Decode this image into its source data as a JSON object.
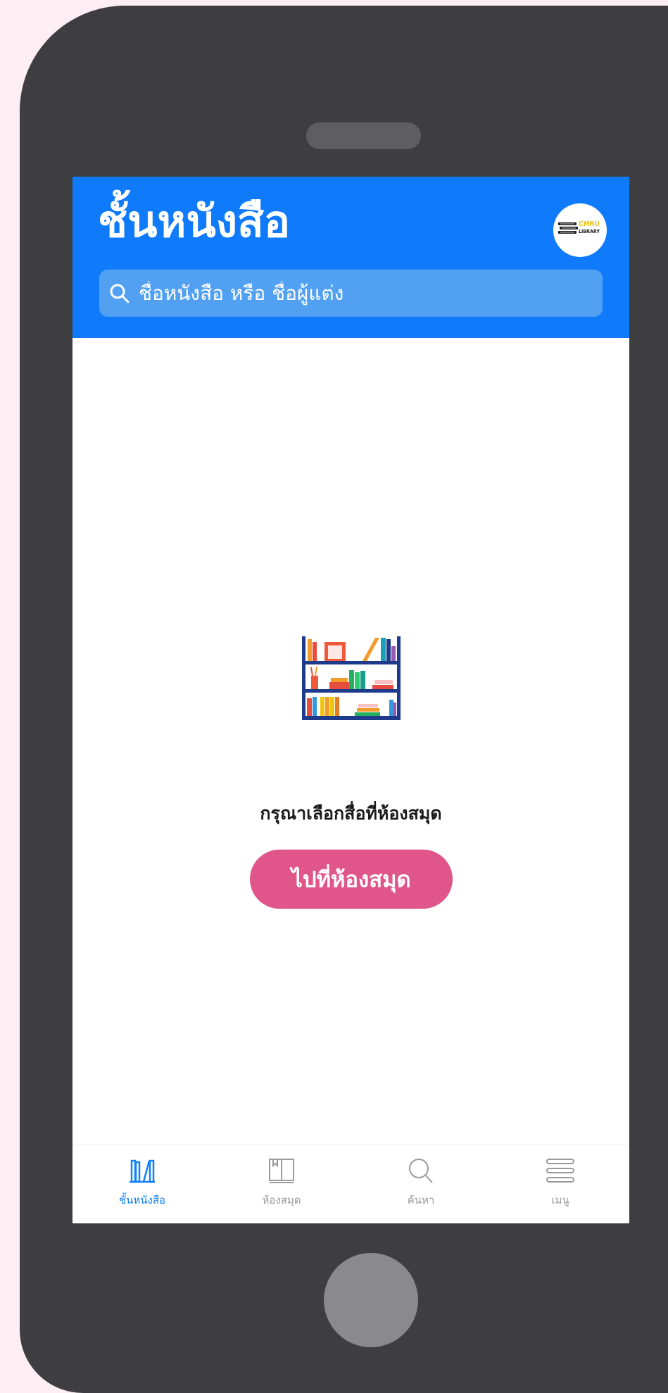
{
  "header": {
    "title": "ชั้นหนังสือ",
    "logo": {
      "line1": "CMRU",
      "line2": "LIBRARY"
    }
  },
  "search": {
    "placeholder": "ชื่อหนังสือ หรือ ชื่อผู้แต่ง",
    "icon": "search-icon"
  },
  "empty_state": {
    "illustration": "bookshelf-illustration",
    "message": "กรุณาเลือกสื่อที่ห้องสมุด",
    "button_label": "ไปที่ห้องสมุด"
  },
  "tabs": [
    {
      "label": "ชั้นหนังสือ",
      "icon": "bookshelf-icon",
      "active": true
    },
    {
      "label": "ห้องสมุด",
      "icon": "book-icon",
      "active": false
    },
    {
      "label": "ค้นหา",
      "icon": "search-icon",
      "active": false
    },
    {
      "label": "เมนู",
      "icon": "menu-icon",
      "active": false
    }
  ],
  "colors": {
    "header": "#0f7bfa",
    "search_bg": "#52a0f2",
    "button": "#e0568a",
    "tab_active": "#1081f6",
    "tab_inactive": "#999999",
    "phone_body": "#3e3e40",
    "background": "#fdeef3"
  }
}
